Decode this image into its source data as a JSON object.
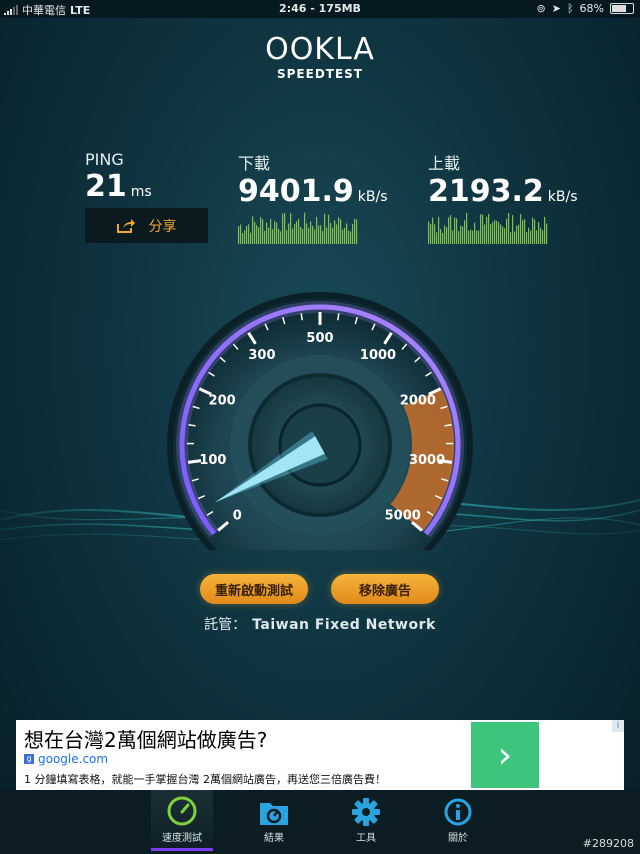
{
  "status": {
    "carrier": "中華電信",
    "network": "LTE",
    "center": "2:46 - 175MB",
    "battery": "68%"
  },
  "logo": {
    "brand": "OOKLA",
    "sub": "SPEEDTEST"
  },
  "stats": {
    "ping": {
      "label": "PING",
      "value": "21",
      "unit": "ms"
    },
    "download": {
      "label": "下載",
      "value": "9401.9",
      "unit": "kB/s"
    },
    "upload": {
      "label": "上載",
      "value": "2193.2",
      "unit": "kB/s"
    }
  },
  "share_label": "分享",
  "gauge": {
    "ticks": [
      "0",
      "100",
      "200",
      "300",
      "500",
      "1000",
      "2000",
      "3000",
      "5000"
    ]
  },
  "buttons": {
    "restart": "重新啟動測試",
    "remove_ads": "移除廣告"
  },
  "hosted": {
    "label": "託管：",
    "name": "Taiwan Fixed Network"
  },
  "ad": {
    "title": "想在台灣2萬個網站做廣告?",
    "url": "google.com",
    "description": "1 分鐘填寫表格，就能一手掌握台灣 2萬個網站廣告，再送您三倍廣告費！",
    "arrow": "›",
    "info": "i"
  },
  "tabs": [
    {
      "label": "速度測試",
      "icon": "speedometer-icon"
    },
    {
      "label": "結果",
      "icon": "results-icon"
    },
    {
      "label": "工具",
      "icon": "gear-icon"
    },
    {
      "label": "關於",
      "icon": "info-icon"
    }
  ],
  "watermark": "#289208",
  "colors": {
    "accent": "#f0a830",
    "ad_button": "#3dc57d",
    "active_tab": "#7c3df0"
  }
}
